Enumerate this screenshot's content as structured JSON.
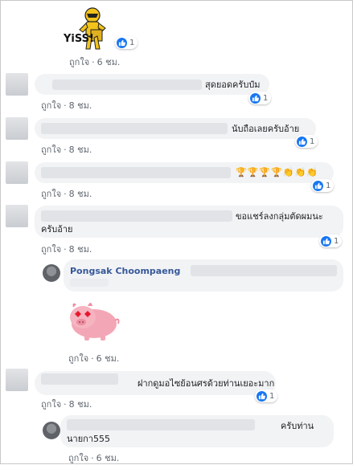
{
  "sticker_top": {
    "text": "YiSS!"
  },
  "reaction_count": "1",
  "like_label": "ถูกใจ",
  "separator": "·",
  "comments": [
    {
      "time": "6 ชม."
    },
    {
      "text": "สุดยอดครับป๋ม",
      "time": "8 ชม."
    },
    {
      "text": "นับถือเลยครับอ้าย",
      "time": "8 ชม."
    },
    {
      "emoji": "🏆🏆🏆🏆👏👏👏",
      "time": "8 ชม."
    },
    {
      "text": "ขอแชร์ลงกลุ่มตัดผมนะ",
      "text2": "ครับอ้าย",
      "time": "8 ชม."
    },
    {
      "author": "Pongsak Choompaeng",
      "time": "6 ชม."
    },
    {
      "text": "ฝากดูมอไซย้อนศรด้วยท่านเยอะมาก",
      "time": "8 ชม."
    },
    {
      "text": "ครับท่าน",
      "text2": "นายกา555",
      "time": "6 ชม."
    }
  ],
  "colors": {
    "accent": "#1877f2",
    "name": "#365899",
    "bubble": "#f2f3f5",
    "meta": "#606770"
  }
}
